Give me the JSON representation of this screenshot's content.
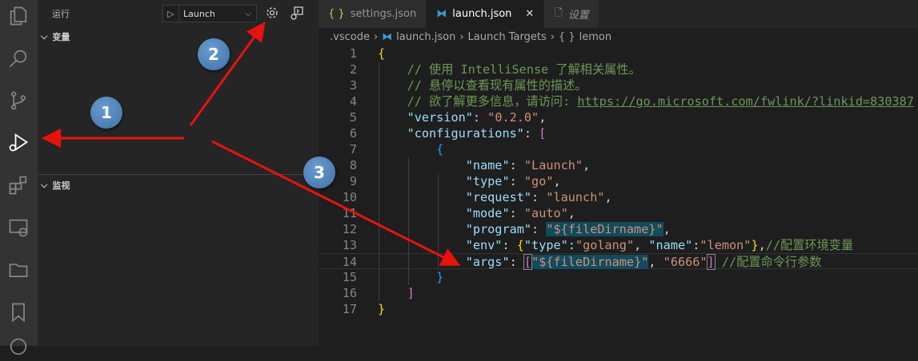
{
  "sidebar": {
    "title": "运行",
    "launch_config": "Launch",
    "sections": [
      {
        "label": "变量"
      },
      {
        "label": "监视"
      }
    ]
  },
  "tabs": [
    {
      "label": "settings.json",
      "icon": "braces-icon"
    },
    {
      "label": "launch.json",
      "icon": "vscode-icon",
      "active": true
    },
    {
      "label": "设置",
      "icon": "file-icon"
    }
  ],
  "breadcrumb": [
    ".vscode",
    "launch.json",
    "Launch Targets",
    "lemon"
  ],
  "annotations": [
    "1",
    "2",
    "3"
  ],
  "code": [
    [
      [
        "{",
        "b1"
      ]
    ],
    [
      [
        "    "
      ],
      [
        "// 使用 IntelliSense 了解相关属性。",
        "com"
      ]
    ],
    [
      [
        "    "
      ],
      [
        "// 悬停以查看现有属性的描述。",
        "com"
      ]
    ],
    [
      [
        "    "
      ],
      [
        "// 欲了解更多信息，请访问: ",
        "com"
      ],
      [
        "https://go.microsoft.com/fwlink/?linkid=830387",
        "url"
      ]
    ],
    [
      [
        "    "
      ],
      [
        "\"version\"",
        "key"
      ],
      [
        ": ",
        "p"
      ],
      [
        "\"0.2.0\"",
        "str"
      ],
      [
        ",",
        "p"
      ]
    ],
    [
      [
        "    "
      ],
      [
        "\"configurations\"",
        "key"
      ],
      [
        ": ",
        "p"
      ],
      [
        "[",
        "b2"
      ]
    ],
    [
      [
        "        "
      ],
      [
        "{",
        "b3"
      ]
    ],
    [
      [
        "            "
      ],
      [
        "\"name\"",
        "key"
      ],
      [
        ": ",
        "p"
      ],
      [
        "\"Launch\"",
        "str"
      ],
      [
        ",",
        "p"
      ]
    ],
    [
      [
        "            "
      ],
      [
        "\"type\"",
        "key"
      ],
      [
        ": ",
        "p"
      ],
      [
        "\"go\"",
        "str"
      ],
      [
        ",",
        "p"
      ]
    ],
    [
      [
        "            "
      ],
      [
        "\"request\"",
        "key"
      ],
      [
        ": ",
        "p"
      ],
      [
        "\"launch\"",
        "str"
      ],
      [
        ",",
        "p"
      ]
    ],
    [
      [
        "            "
      ],
      [
        "\"mode\"",
        "key"
      ],
      [
        ": ",
        "p"
      ],
      [
        "\"auto\"",
        "str"
      ],
      [
        ",",
        "p"
      ]
    ],
    [
      [
        "            "
      ],
      [
        "\"program\"",
        "key"
      ],
      [
        ": ",
        "p"
      ],
      [
        "\"${fileDirname}\"",
        "str hl"
      ],
      [
        ",",
        "p"
      ]
    ],
    [
      [
        "            "
      ],
      [
        "\"env\"",
        "key"
      ],
      [
        ": ",
        "p"
      ],
      [
        "{",
        "b1"
      ],
      [
        "\"type\"",
        "key"
      ],
      [
        ":",
        "p"
      ],
      [
        "\"golang\"",
        "str"
      ],
      [
        ", ",
        "p"
      ],
      [
        "\"name\"",
        "key"
      ],
      [
        ":",
        "p"
      ],
      [
        "\"lemon\"",
        "str"
      ],
      [
        "}",
        "b1"
      ],
      [
        ",",
        "p"
      ],
      [
        "//配置环境变量",
        "com"
      ]
    ],
    [
      [
        "            "
      ],
      [
        "\"args\"",
        "key"
      ],
      [
        ": ",
        "p"
      ],
      [
        "[",
        "b2 bm"
      ],
      [
        "\"${fileDirname}\"",
        "str hl"
      ],
      [
        ", ",
        "p"
      ],
      [
        "\"6666\"",
        "str"
      ],
      [
        "]",
        "b2 bm"
      ],
      [
        " ",
        "p"
      ],
      [
        "//配置命令行参数",
        "com"
      ]
    ],
    [
      [
        "        "
      ],
      [
        "}",
        "b3"
      ]
    ],
    [
      [
        "    "
      ],
      [
        "]",
        "b2"
      ]
    ],
    [
      [
        "}",
        "b1"
      ]
    ]
  ]
}
